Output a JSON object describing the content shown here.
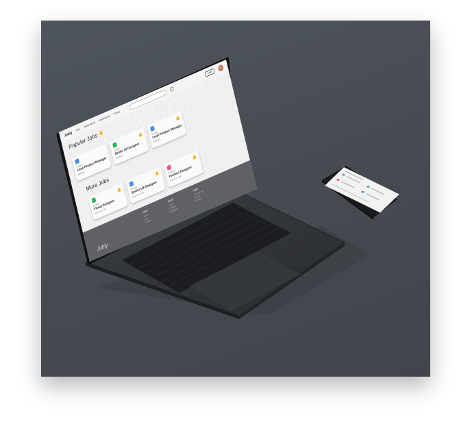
{
  "site": {
    "brand": "Jobly",
    "nav": [
      "Jobs",
      "Applications",
      "Notifications",
      "Saves"
    ],
    "login_label": "Login"
  },
  "sections": {
    "popular_title": "Popular Jobs",
    "more_title": "More Jobs"
  },
  "popular_jobs": [
    {
      "company": "Google",
      "title": "Lead Product Manager",
      "salary": "$2500/m",
      "location": "Toronto, Canada",
      "logo_color": "#4a8fe0"
    },
    {
      "company": "Spotify",
      "title": "Senior UI Designer",
      "salary": "$2500/m",
      "location": "Toronto, Canada",
      "logo_color": "#2fb65a"
    },
    {
      "company": "Google",
      "title": "Lead Product Manager",
      "salary": "$2500/m",
      "location": "Toronto, Canada",
      "logo_color": "#4a8fe0"
    }
  ],
  "more_jobs": [
    {
      "company": "Spotify",
      "title": "Visual Designer",
      "salary": "$2500/m",
      "location": "New York, USA",
      "logo_color": "#2fb65a"
    },
    {
      "company": "Google",
      "title": "Senior UX Designer",
      "salary": "$2500/m",
      "location": "New York, USA",
      "logo_color": "#4a8fe0"
    },
    {
      "company": "Dribbble",
      "title": "Product Designer",
      "salary": "$2500/m",
      "location": "New York, USA",
      "logo_color": "#e05a8a"
    }
  ],
  "footer": {
    "brand": "Jobly",
    "col1": {
      "title": "Jobly",
      "links": [
        "About",
        "Jobs",
        "Contact"
      ]
    },
    "col2": {
      "title": "Social",
      "links": [
        "Twitter",
        "Dribbble",
        "Instagram"
      ]
    },
    "col3": {
      "title": "Legal",
      "links": [
        "Terms of use",
        "Privacy",
        "Cookies"
      ]
    }
  }
}
